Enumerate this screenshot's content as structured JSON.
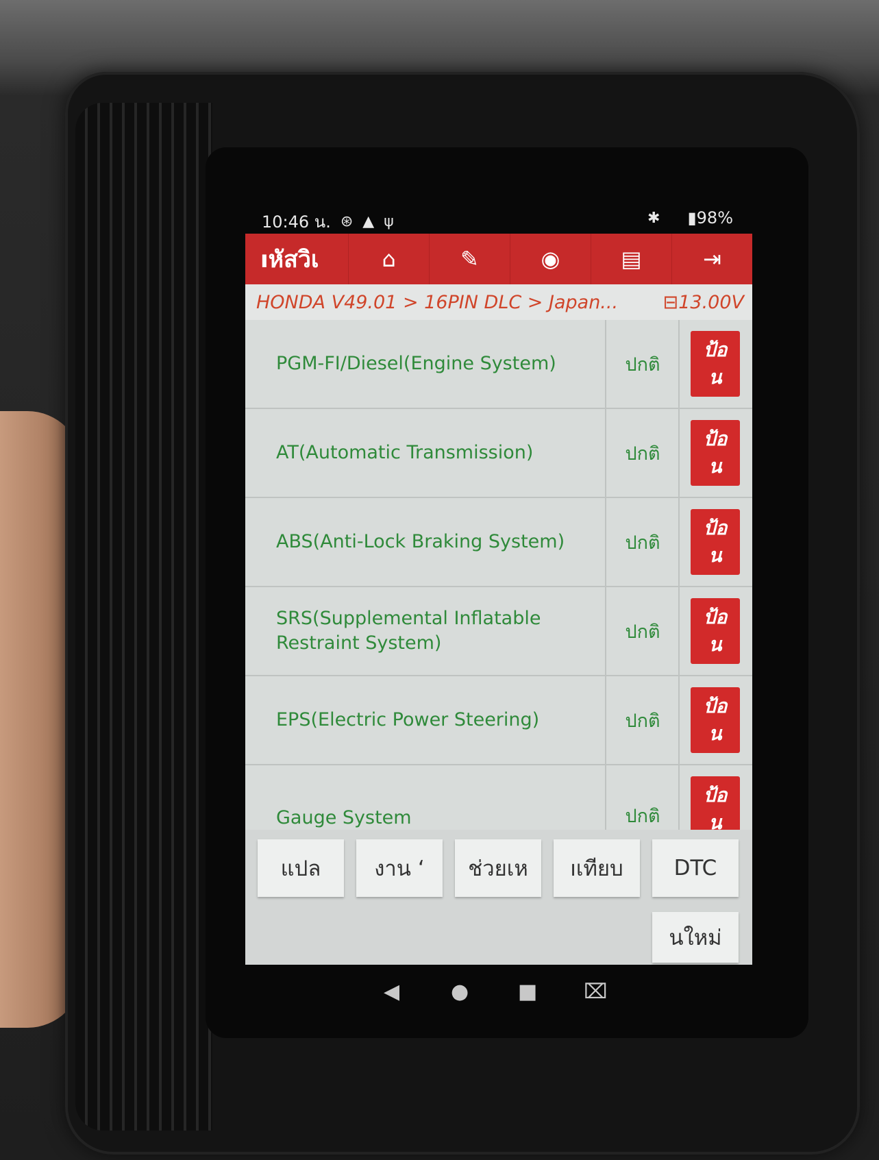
{
  "status_bar": {
    "time": "10:46 น.",
    "icons": [
      "bluetooth-settings-icon",
      "warning-icon",
      "usb-icon"
    ],
    "bluetooth_icon": "bluetooth-icon",
    "battery": "98%"
  },
  "toolbar": {
    "title": "ıหัสวิเ",
    "buttons": [
      "home-icon",
      "edit-icon",
      "profile-icon",
      "print-icon",
      "exit-icon"
    ]
  },
  "breadcrumb": {
    "path": "HONDA V49.01 > 16PIN DLC > Japan...",
    "voltage": "13.00V"
  },
  "systems": [
    {
      "name": "PGM-FI/Diesel(Engine System)",
      "status": "ปกติ",
      "action": "ป้อ\nน"
    },
    {
      "name": "AT(Automatic Transmission)",
      "status": "ปกติ",
      "action": "ป้อ\nน"
    },
    {
      "name": "ABS(Anti-Lock Braking System)",
      "status": "ปกติ",
      "action": "ป้อ\nน"
    },
    {
      "name": "SRS(Supplemental Inflatable Restraint System)",
      "status": "ปกติ",
      "action": "ป้อ\nน"
    },
    {
      "name": "EPS(Electric Power Steering)",
      "status": "ปกติ",
      "action": "ป้อ\nน"
    },
    {
      "name": "Gauge System",
      "status": "ปกติ",
      "action": "ป้อ\nน"
    }
  ],
  "bottom_buttons": {
    "b1": "แปล",
    "b2": "งาน  ʻ",
    "b3": "ช่วยเห",
    "b4": "ıเทียบ",
    "b5": "DTC",
    "b6": "นใหม่"
  },
  "colors": {
    "toolbar": "#c62a2a",
    "system_text": "#2f8a3a",
    "breadcrumb_text": "#d0452a",
    "action_button": "#d22a2a"
  }
}
